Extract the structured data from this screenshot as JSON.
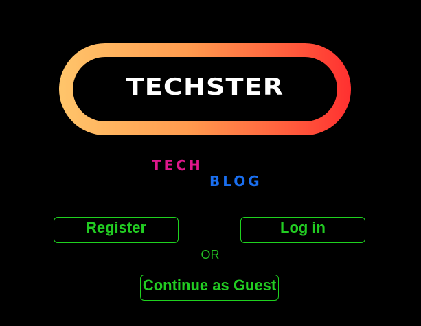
{
  "logo": {
    "title": "TECHSTER",
    "subtitle_top": "TECH",
    "subtitle_bottom": "BLOG"
  },
  "colors": {
    "background": "#000000",
    "gradient_start": "#ffc56b",
    "gradient_end": "#ff3030",
    "tech_pink": "#e0178c",
    "blog_blue": "#1a6ff0",
    "accent_green": "#22cc22"
  },
  "actions": {
    "register_label": "Register",
    "login_label": "Log in",
    "or_label": "OR",
    "guest_label": "Continue as Guest"
  }
}
